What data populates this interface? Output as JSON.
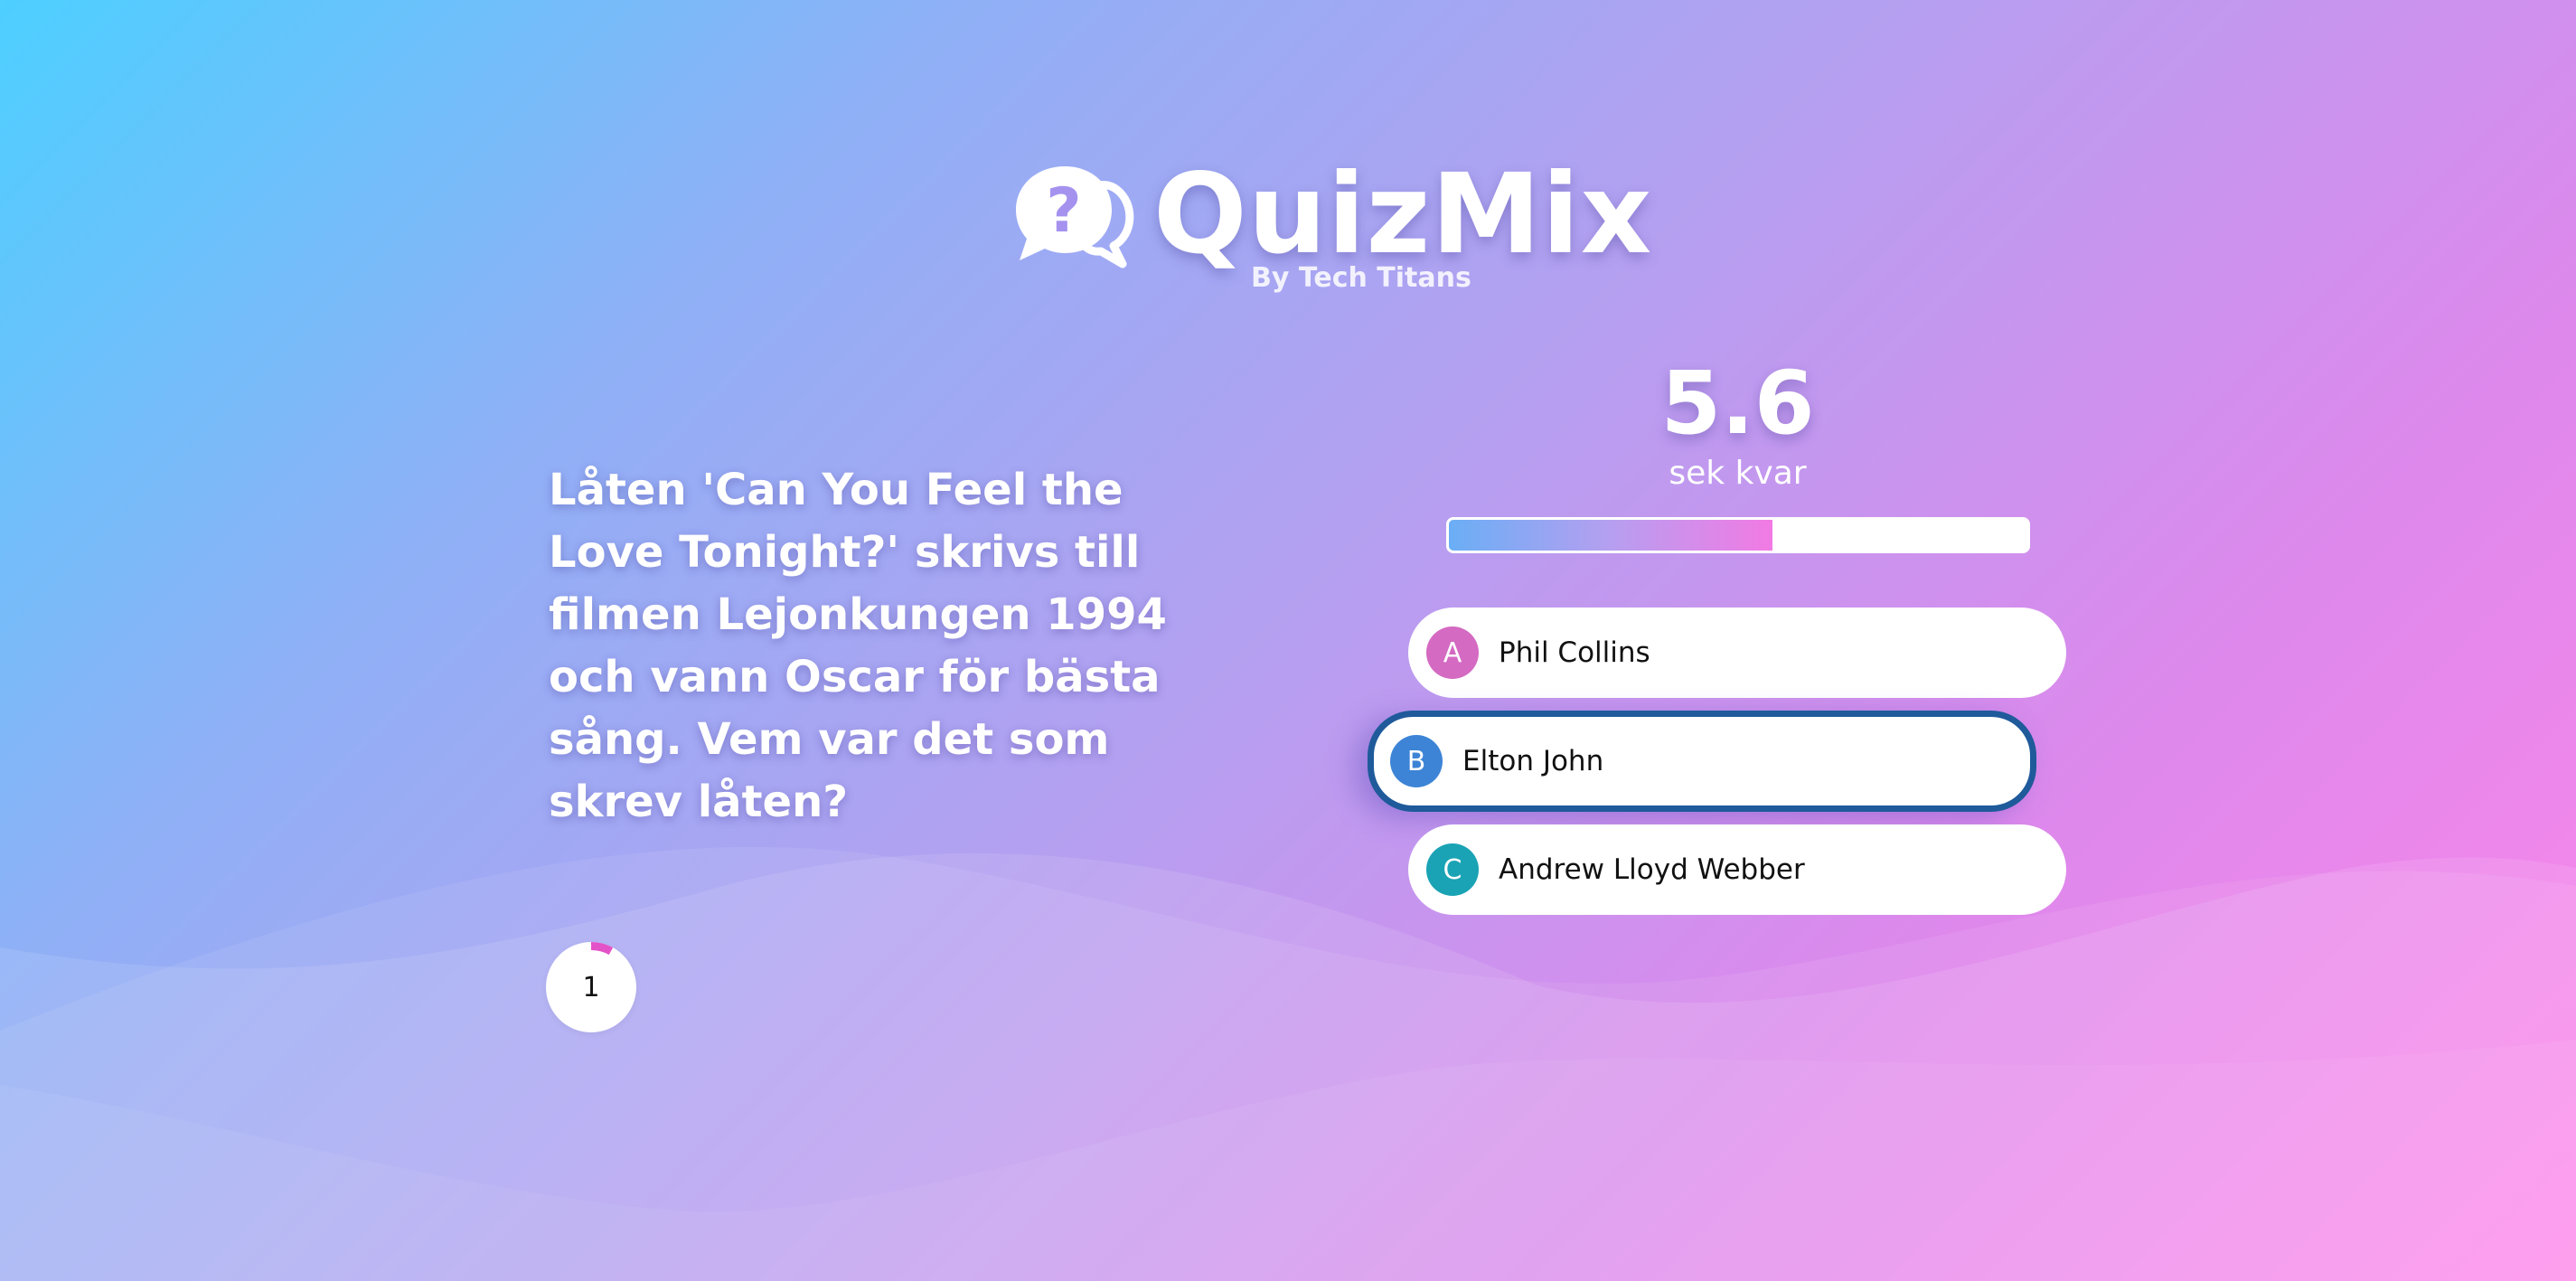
{
  "app": {
    "title": "QuizMix",
    "subtitle": "By Tech Titans",
    "logo_icon": "chat-question-icon"
  },
  "question": {
    "text": "Låten 'Can You Feel the Love Tonight?' skrivs till filmen Lejonkungen 1994 och vann Oscar för bästa sång. Vem var det som skrev låten?",
    "number": "1",
    "number_ring_progress": 0.08
  },
  "timer": {
    "value": "5.6",
    "label": "sek kvar",
    "progress": 0.56
  },
  "answers": [
    {
      "letter": "A",
      "text": "Phil Collins",
      "color": "#d46ac2",
      "selected": false
    },
    {
      "letter": "B",
      "text": "Elton John",
      "color": "#3d84d6",
      "selected": true
    },
    {
      "letter": "C",
      "text": "Andrew Lloyd Webber",
      "color": "#1aa3b5",
      "selected": false
    }
  ],
  "colors": {
    "selected_border": "#1f5a9b",
    "progress_start": "#6aaef5",
    "progress_end": "#f27ae4"
  }
}
